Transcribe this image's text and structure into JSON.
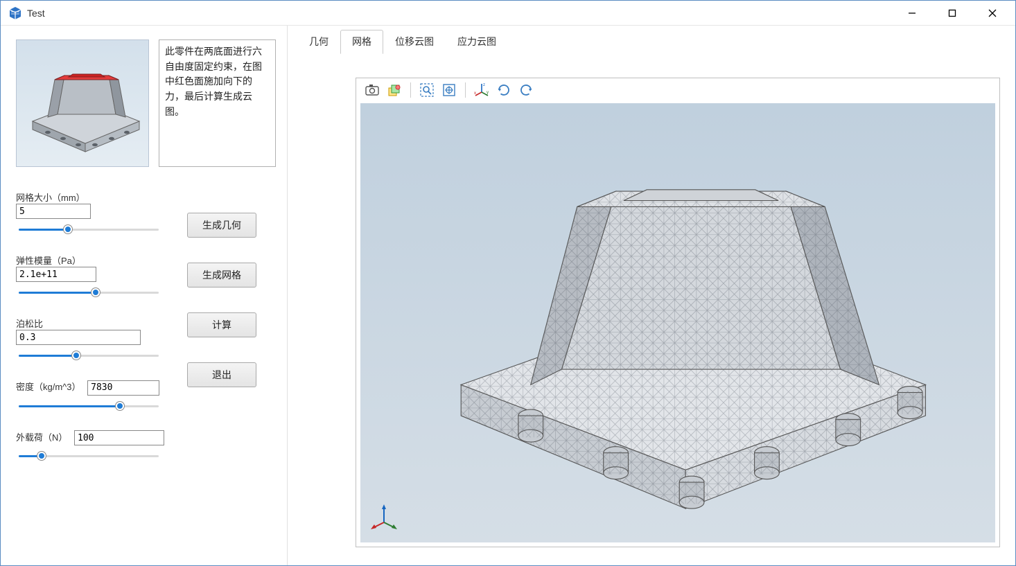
{
  "titlebar": {
    "app_title": "Test"
  },
  "description": "此零件在两底面进行六自由度固定约束，在图中红色面施加向下的力，最后计算生成云图。",
  "tabs": [
    {
      "id": "geometry",
      "label": "几何",
      "active": false
    },
    {
      "id": "mesh",
      "label": "网格",
      "active": true
    },
    {
      "id": "displacement",
      "label": "位移云图",
      "active": false
    },
    {
      "id": "stress",
      "label": "应力云图",
      "active": false
    }
  ],
  "params": {
    "mesh_size": {
      "label": "网格大小（mm）",
      "value": "5",
      "slider_pct": 36
    },
    "elastic_modulus": {
      "label": "弹性模量（Pa）",
      "value": "2.1e+11",
      "slider_pct": 55
    },
    "poisson_ratio": {
      "label": "泊松比",
      "value": "0.3",
      "slider_pct": 42
    },
    "density": {
      "label": "密度（kg/m^3）",
      "value": "7830",
      "slider_pct": 72
    },
    "external_load": {
      "label": "外载荷（N）",
      "value": "100",
      "slider_pct": 18
    }
  },
  "buttons": {
    "generate_geometry": "生成几何",
    "generate_mesh": "生成网格",
    "compute": "计算",
    "exit": "退出"
  },
  "toolbar_icons": [
    "camera-icon",
    "stack-icon",
    "zoom-window-icon",
    "fit-view-icon",
    "axis-icon",
    "rotate-cw-icon",
    "rotate-ccw-icon"
  ]
}
